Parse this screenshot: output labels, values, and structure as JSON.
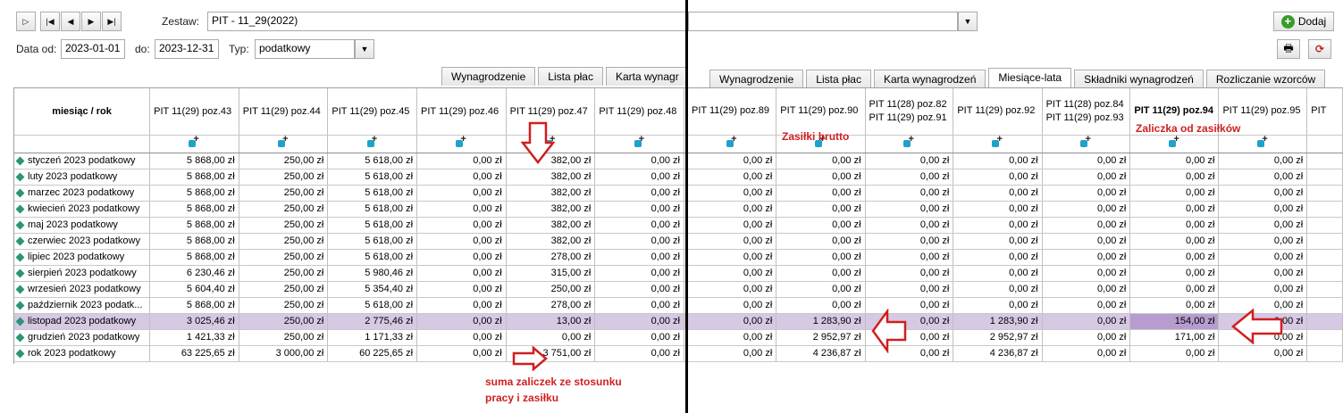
{
  "filters": {
    "zestaw_label": "Zestaw:",
    "zestaw_value": "PIT - 11_29(2022)",
    "data_od_label": "Data od:",
    "data_od_value": "2023-01-01",
    "do_label": "do:",
    "do_value": "2023-12-31",
    "typ_label": "Typ:",
    "typ_value": "podatkowy"
  },
  "toolbar": {
    "add_label": "Dodaj"
  },
  "left_tabs": [
    "Wynagrodzenie",
    "Lista płac",
    "Karta wynagr"
  ],
  "right_tabs": [
    "Wynagrodzenie",
    "Lista płac",
    "Karta wynagrodzeń",
    "Miesiące-lata",
    "Składniki wynagrodzeń",
    "Rozliczanie wzorców"
  ],
  "left_grid": {
    "row_header": "miesiąc / rok",
    "columns": [
      "PIT 11(29) poz.43",
      "PIT 11(29) poz.44",
      "PIT 11(29) poz.45",
      "PIT 11(29) poz.46",
      "PIT 11(29) poz.47",
      "PIT 11(29) poz.48"
    ],
    "rows": [
      {
        "label": "styczeń 2023 podatkowy",
        "values": [
          "5 868,00 zł",
          "250,00 zł",
          "5 618,00 zł",
          "0,00 zł",
          "382,00 zł",
          "0,00 zł"
        ]
      },
      {
        "label": "luty 2023 podatkowy",
        "values": [
          "5 868,00 zł",
          "250,00 zł",
          "5 618,00 zł",
          "0,00 zł",
          "382,00 zł",
          "0,00 zł"
        ]
      },
      {
        "label": "marzec 2023 podatkowy",
        "values": [
          "5 868,00 zł",
          "250,00 zł",
          "5 618,00 zł",
          "0,00 zł",
          "382,00 zł",
          "0,00 zł"
        ]
      },
      {
        "label": "kwiecień 2023 podatkowy",
        "values": [
          "5 868,00 zł",
          "250,00 zł",
          "5 618,00 zł",
          "0,00 zł",
          "382,00 zł",
          "0,00 zł"
        ]
      },
      {
        "label": "maj 2023 podatkowy",
        "values": [
          "5 868,00 zł",
          "250,00 zł",
          "5 618,00 zł",
          "0,00 zł",
          "382,00 zł",
          "0,00 zł"
        ]
      },
      {
        "label": "czerwiec 2023 podatkowy",
        "values": [
          "5 868,00 zł",
          "250,00 zł",
          "5 618,00 zł",
          "0,00 zł",
          "382,00 zł",
          "0,00 zł"
        ]
      },
      {
        "label": "lipiec 2023 podatkowy",
        "values": [
          "5 868,00 zł",
          "250,00 zł",
          "5 618,00 zł",
          "0,00 zł",
          "278,00 zł",
          "0,00 zł"
        ]
      },
      {
        "label": "sierpień 2023 podatkowy",
        "values": [
          "6 230,46 zł",
          "250,00 zł",
          "5 980,46 zł",
          "0,00 zł",
          "315,00 zł",
          "0,00 zł"
        ]
      },
      {
        "label": "wrzesień 2023 podatkowy",
        "values": [
          "5 604,40 zł",
          "250,00 zł",
          "5 354,40 zł",
          "0,00 zł",
          "250,00 zł",
          "0,00 zł"
        ]
      },
      {
        "label": "październik 2023 podatk...",
        "values": [
          "5 868,00 zł",
          "250,00 zł",
          "5 618,00 zł",
          "0,00 zł",
          "278,00 zł",
          "0,00 zł"
        ]
      },
      {
        "label": "listopad 2023 podatkowy",
        "values": [
          "3 025,46 zł",
          "250,00 zł",
          "2 775,46 zł",
          "0,00 zł",
          "13,00 zł",
          "0,00 zł"
        ],
        "selected": true
      },
      {
        "label": "grudzień 2023 podatkowy",
        "values": [
          "1 421,33 zł",
          "250,00 zł",
          "1 171,33 zł",
          "0,00 zł",
          "0,00 zł",
          "0,00 zł"
        ]
      },
      {
        "label": "rok 2023 podatkowy",
        "values": [
          "63 225,65 zł",
          "3 000,00 zł",
          "60 225,65 zł",
          "0,00 zł",
          "3 751,00 zł",
          "0,00 zł"
        ]
      }
    ]
  },
  "right_grid": {
    "columns": [
      "PIT 11(29) poz.89",
      "PIT 11(29) poz.90",
      "PIT 11(28) poz.82\nPIT 11(29) poz.91",
      "PIT 11(29) poz.92",
      "PIT 11(28) poz.84\nPIT 11(29) poz.93",
      "PIT 11(29) poz.94",
      "PIT 11(29) poz.95",
      "PIT"
    ],
    "rows": [
      {
        "values": [
          "0,00 zł",
          "0,00 zł",
          "0,00 zł",
          "0,00 zł",
          "0,00 zł",
          "0,00 zł",
          "0,00 zł",
          ""
        ]
      },
      {
        "values": [
          "0,00 zł",
          "0,00 zł",
          "0,00 zł",
          "0,00 zł",
          "0,00 zł",
          "0,00 zł",
          "0,00 zł",
          ""
        ]
      },
      {
        "values": [
          "0,00 zł",
          "0,00 zł",
          "0,00 zł",
          "0,00 zł",
          "0,00 zł",
          "0,00 zł",
          "0,00 zł",
          ""
        ]
      },
      {
        "values": [
          "0,00 zł",
          "0,00 zł",
          "0,00 zł",
          "0,00 zł",
          "0,00 zł",
          "0,00 zł",
          "0,00 zł",
          ""
        ]
      },
      {
        "values": [
          "0,00 zł",
          "0,00 zł",
          "0,00 zł",
          "0,00 zł",
          "0,00 zł",
          "0,00 zł",
          "0,00 zł",
          ""
        ]
      },
      {
        "values": [
          "0,00 zł",
          "0,00 zł",
          "0,00 zł",
          "0,00 zł",
          "0,00 zł",
          "0,00 zł",
          "0,00 zł",
          ""
        ]
      },
      {
        "values": [
          "0,00 zł",
          "0,00 zł",
          "0,00 zł",
          "0,00 zł",
          "0,00 zł",
          "0,00 zł",
          "0,00 zł",
          ""
        ]
      },
      {
        "values": [
          "0,00 zł",
          "0,00 zł",
          "0,00 zł",
          "0,00 zł",
          "0,00 zł",
          "0,00 zł",
          "0,00 zł",
          ""
        ]
      },
      {
        "values": [
          "0,00 zł",
          "0,00 zł",
          "0,00 zł",
          "0,00 zł",
          "0,00 zł",
          "0,00 zł",
          "0,00 zł",
          ""
        ]
      },
      {
        "values": [
          "0,00 zł",
          "0,00 zł",
          "0,00 zł",
          "0,00 zł",
          "0,00 zł",
          "0,00 zł",
          "0,00 zł",
          ""
        ]
      },
      {
        "values": [
          "0,00 zł",
          "1 283,90 zł",
          "0,00 zł",
          "1 283,90 zł",
          "0,00 zł",
          "154,00 zł",
          "0,00 zł",
          ""
        ],
        "selected": true
      },
      {
        "values": [
          "0,00 zł",
          "2 952,97 zł",
          "0,00 zł",
          "2 952,97 zł",
          "0,00 zł",
          "171,00 zł",
          "0,00 zł",
          ""
        ]
      },
      {
        "values": [
          "0,00 zł",
          "4 236,87 zł",
          "0,00 zł",
          "4 236,87 zł",
          "0,00 zł",
          "0,00 zł",
          "0,00 zł",
          ""
        ]
      }
    ]
  },
  "annotations": {
    "zasilki_brutto": "Zasiłki brutto",
    "zaliczka_od_zasilkow": "Zaliczka od zasiłków",
    "suma_line1": "suma zaliczek ze stosunku",
    "suma_line2": "pracy i zasiłku"
  },
  "colors": {
    "annotation": "#d01f1f",
    "selected_row": "#d7c8e3",
    "selected_cell": "#b79ccf",
    "row_icon": "#2b9478"
  }
}
